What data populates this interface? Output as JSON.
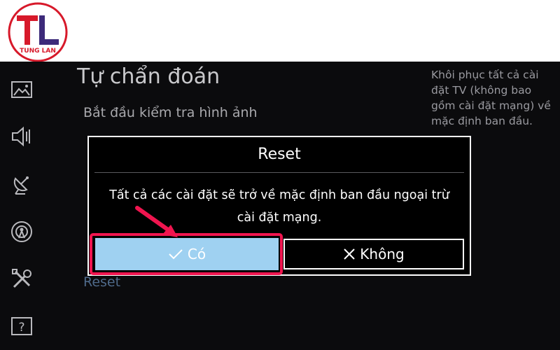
{
  "logo": {
    "text": "TUNG LAN",
    "brand_color": "#d7192a"
  },
  "page": {
    "title": "Tự chẩn đoán"
  },
  "menu": {
    "items": [
      {
        "label": "Bắt đầu kiểm tra hình ảnh"
      },
      {
        "label": "Reset"
      }
    ]
  },
  "help": {
    "text": "Khôi phục tất cả cài đặt TV (không bao gồm cài đặt mạng) về mặc định ban đầu."
  },
  "dialog": {
    "title": "Reset",
    "message": "Tất cả các cài đặt sẽ trở về mặc định ban đầu ngoại trừ cài đặt mạng.",
    "yes_label": "Có",
    "no_label": "Không",
    "highlight_color": "#f0154f",
    "selected_color": "#9fd1f1"
  },
  "sidebar": {
    "icons": [
      "picture-icon",
      "sound-icon",
      "broadcast-icon",
      "network-icon",
      "tools-icon",
      "help-icon"
    ]
  }
}
